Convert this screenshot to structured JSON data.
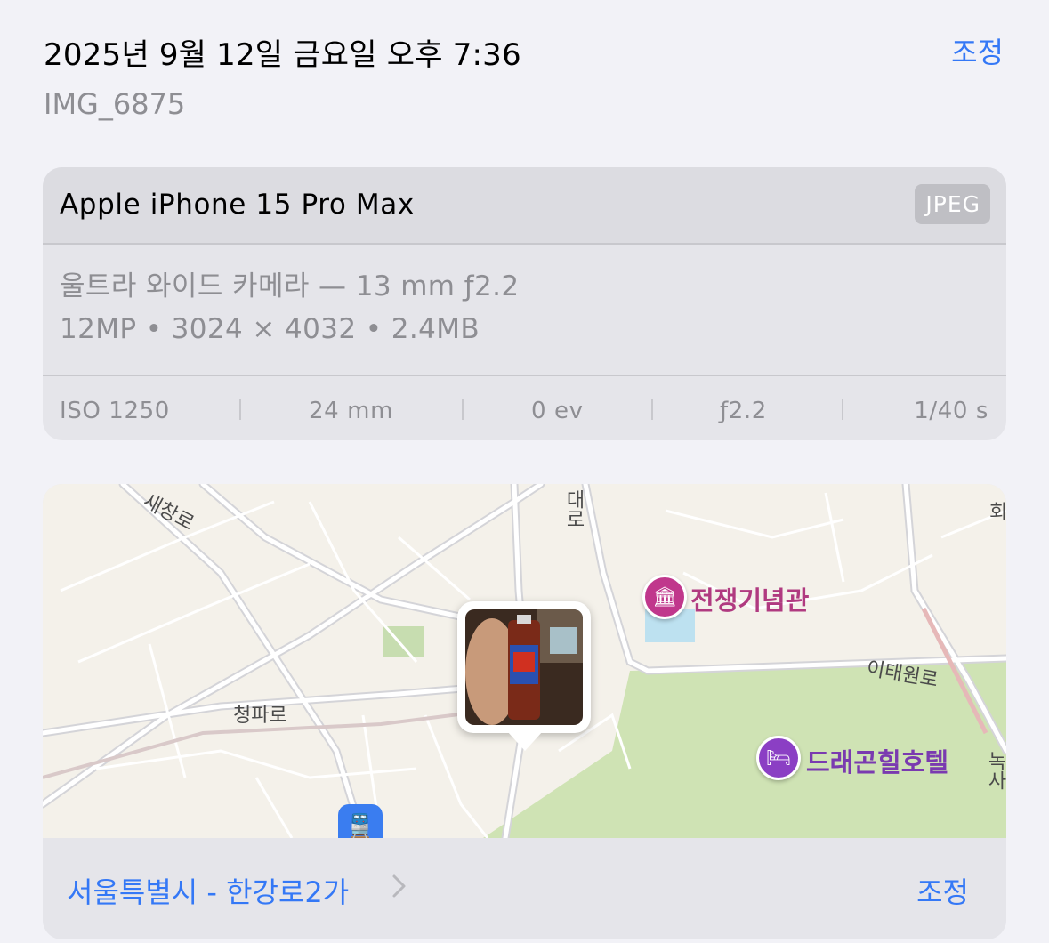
{
  "header": {
    "datetime": "2025년 9월 12일 금요일 오후 7:36",
    "adjust_label": "조정",
    "filename": "IMG_6875"
  },
  "camera": {
    "device": "Apple iPhone 15 Pro Max",
    "format": "JPEG",
    "lens": "울트라 와이드 카메라 — 13 mm ƒ2.2",
    "specs": "12MP  •  3024 × 4032  •  2.4MB",
    "exif": {
      "iso": "ISO 1250",
      "focal": "24 mm",
      "ev": "0 ev",
      "aperture": "ƒ2.2",
      "shutter": "1/40 s"
    }
  },
  "map": {
    "road_labels": {
      "saechang": "새창로",
      "dae": "대로",
      "hoe": "회",
      "itaewon": "이태원로",
      "cheongpa": "청파로",
      "nok": "녹사"
    },
    "pois": {
      "museum": "전쟁기념관",
      "hotel": "드래곤힐호텔"
    },
    "icons": {
      "museum": "museum-icon",
      "hotel": "bed-icon",
      "transit": "train-icon"
    },
    "colors": {
      "museum": "#c0378c",
      "hotel": "#8b3fc4",
      "park": "#cfe3b4",
      "transit": "#3a7df0"
    }
  },
  "location": {
    "label": "서울특별시 - 한강로2가",
    "adjust_label": "조정"
  },
  "accent": "#3478f6"
}
